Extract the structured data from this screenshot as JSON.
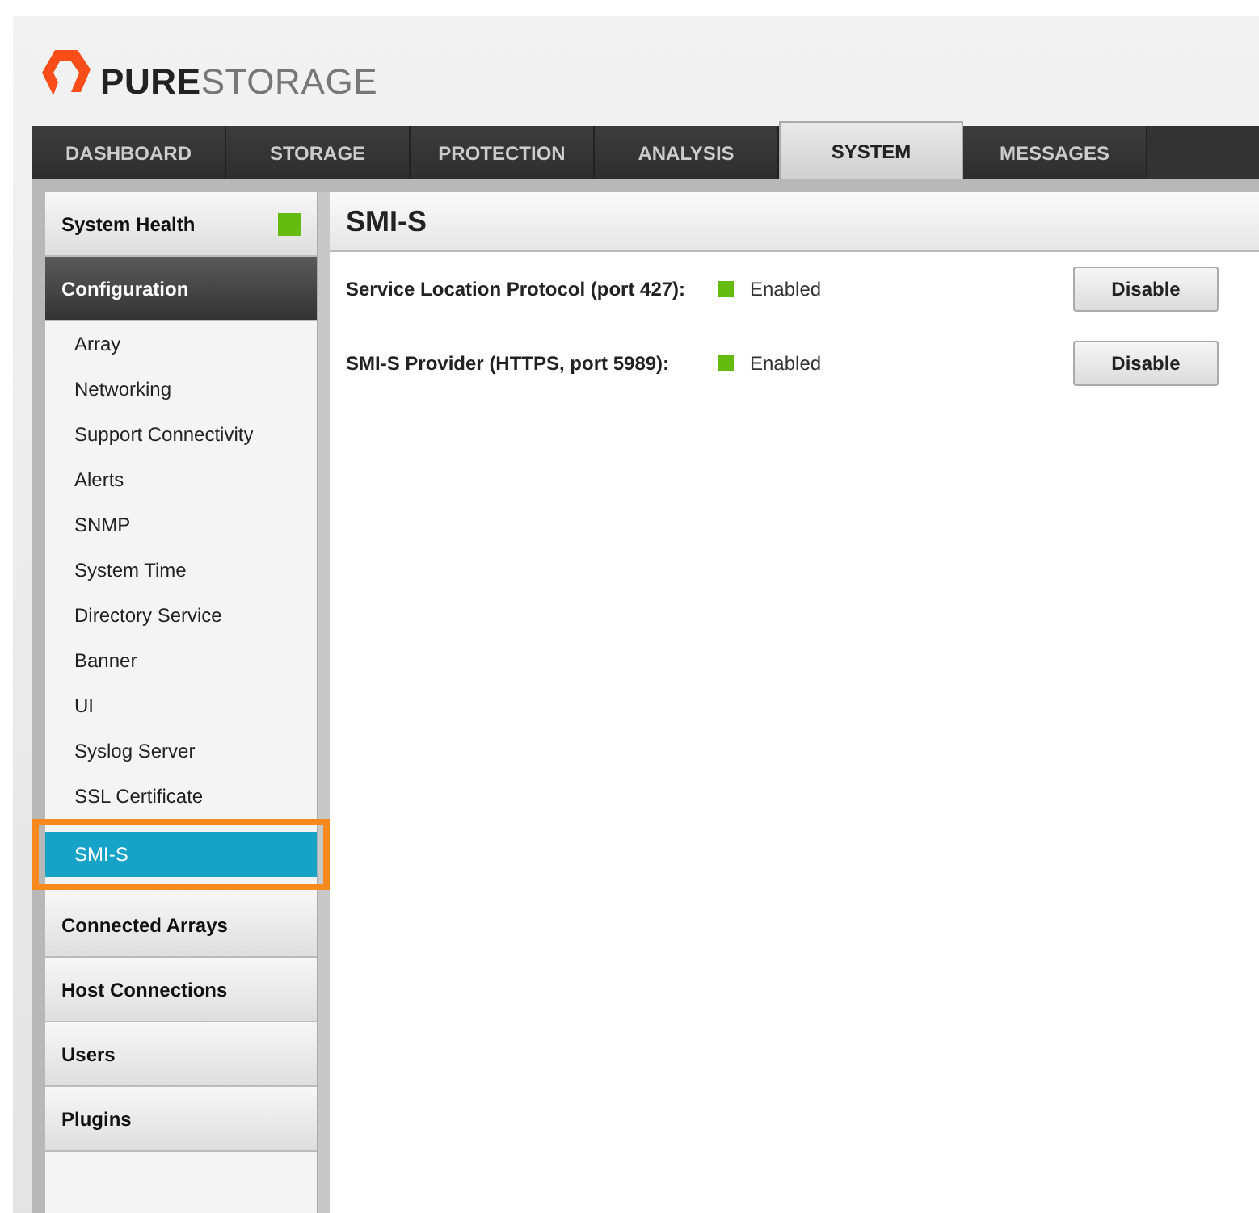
{
  "logo": {
    "brand_bold": "PURE",
    "brand_light": "STORAGE"
  },
  "tabs": [
    {
      "label": "DASHBOARD",
      "selected": false
    },
    {
      "label": "STORAGE",
      "selected": false
    },
    {
      "label": "PROTECTION",
      "selected": false
    },
    {
      "label": "ANALYSIS",
      "selected": false
    },
    {
      "label": "SYSTEM",
      "selected": true
    },
    {
      "label": "MESSAGES",
      "selected": false
    }
  ],
  "sidebar": {
    "sections": [
      {
        "label": "System Health",
        "selected": false,
        "color": "#66bb11"
      },
      {
        "label": "Configuration",
        "selected": true,
        "expanded": true,
        "items": [
          {
            "label": "Array",
            "selected": false,
            "highlighted": false
          },
          {
            "label": "Networking",
            "selected": false,
            "highlighted": false
          },
          {
            "label": "Support Connectivity",
            "selected": false,
            "highlighted": false
          },
          {
            "label": "Alerts",
            "selected": false,
            "highlighted": false
          },
          {
            "label": "SNMP",
            "selected": false,
            "highlighted": false
          },
          {
            "label": "System Time",
            "selected": false,
            "highlighted": false
          },
          {
            "label": "Directory Service",
            "selected": false,
            "highlighted": false
          },
          {
            "label": "Banner",
            "selected": false,
            "highlighted": false
          },
          {
            "label": "UI",
            "selected": false,
            "highlighted": false
          },
          {
            "label": "Syslog Server",
            "selected": false,
            "highlighted": false
          },
          {
            "label": "SSL Certificate",
            "selected": false,
            "highlighted": false
          },
          {
            "label": "SMI-S",
            "selected": true,
            "highlighted": true
          }
        ]
      },
      {
        "label": "Connected Arrays",
        "selected": false
      },
      {
        "label": "Host Connections",
        "selected": false
      },
      {
        "label": "Users",
        "selected": false
      },
      {
        "label": "Plugins",
        "selected": false
      }
    ]
  },
  "panel": {
    "title": "SMI-S",
    "services": [
      {
        "label": "Service Location Protocol (port 427):",
        "enabled": true,
        "status": "Enabled",
        "button": "Disable"
      },
      {
        "label": "SMI-S Provider (HTTPS, port 5989):",
        "enabled": true,
        "status": "Enabled",
        "button": "Disable"
      }
    ]
  }
}
